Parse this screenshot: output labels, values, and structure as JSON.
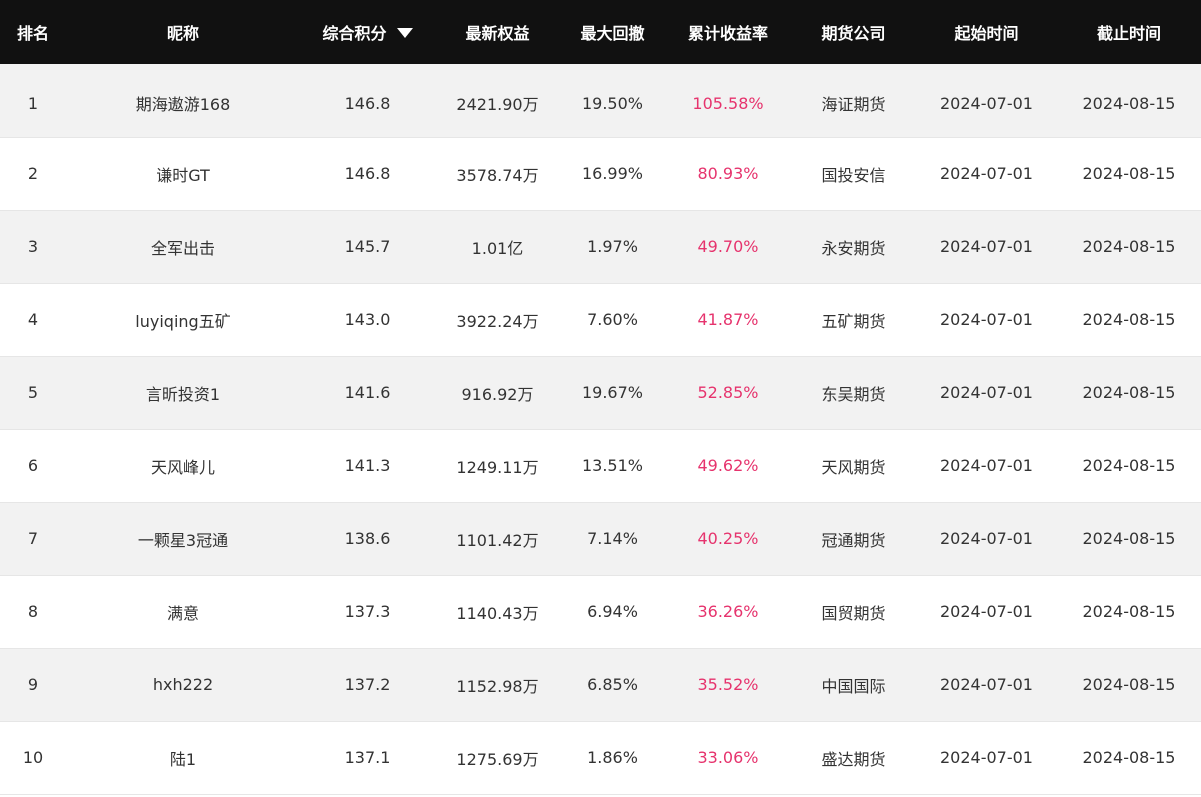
{
  "columns": {
    "rank": "排名",
    "nickname": "昵称",
    "score": "综合积分",
    "equity": "最新权益",
    "drawdown": "最大回撤",
    "return": "累计收益率",
    "company": "期货公司",
    "start": "起始时间",
    "end": "截止时间"
  },
  "sort": {
    "column": "score",
    "direction": "desc",
    "icon": "sort-down-triangle"
  },
  "colors": {
    "header_bg": "#111111",
    "return_color": "#e6336d",
    "stripe": "#f2f2f2"
  },
  "rows": [
    {
      "rank": "1",
      "nickname": "期海遨游168",
      "score": "146.8",
      "equity": "2421.90万",
      "drawdown": "19.50%",
      "return": "105.58%",
      "company": "海证期货",
      "start": "2024-07-01",
      "end": "2024-08-15"
    },
    {
      "rank": "2",
      "nickname": "谦时GT",
      "score": "146.8",
      "equity": "3578.74万",
      "drawdown": "16.99%",
      "return": "80.93%",
      "company": "国投安信",
      "start": "2024-07-01",
      "end": "2024-08-15"
    },
    {
      "rank": "3",
      "nickname": "全军出击",
      "score": "145.7",
      "equity": "1.01亿",
      "drawdown": "1.97%",
      "return": "49.70%",
      "company": "永安期货",
      "start": "2024-07-01",
      "end": "2024-08-15"
    },
    {
      "rank": "4",
      "nickname": "luyiqing五矿",
      "score": "143.0",
      "equity": "3922.24万",
      "drawdown": "7.60%",
      "return": "41.87%",
      "company": "五矿期货",
      "start": "2024-07-01",
      "end": "2024-08-15"
    },
    {
      "rank": "5",
      "nickname": "言昕投资1",
      "score": "141.6",
      "equity": "916.92万",
      "drawdown": "19.67%",
      "return": "52.85%",
      "company": "东吴期货",
      "start": "2024-07-01",
      "end": "2024-08-15"
    },
    {
      "rank": "6",
      "nickname": "天风峰儿",
      "score": "141.3",
      "equity": "1249.11万",
      "drawdown": "13.51%",
      "return": "49.62%",
      "company": "天风期货",
      "start": "2024-07-01",
      "end": "2024-08-15"
    },
    {
      "rank": "7",
      "nickname": "一颗星3冠通",
      "score": "138.6",
      "equity": "1101.42万",
      "drawdown": "7.14%",
      "return": "40.25%",
      "company": "冠通期货",
      "start": "2024-07-01",
      "end": "2024-08-15"
    },
    {
      "rank": "8",
      "nickname": "满意",
      "score": "137.3",
      "equity": "1140.43万",
      "drawdown": "6.94%",
      "return": "36.26%",
      "company": "国贸期货",
      "start": "2024-07-01",
      "end": "2024-08-15"
    },
    {
      "rank": "9",
      "nickname": "hxh222",
      "score": "137.2",
      "equity": "1152.98万",
      "drawdown": "6.85%",
      "return": "35.52%",
      "company": "中国国际",
      "start": "2024-07-01",
      "end": "2024-08-15"
    },
    {
      "rank": "10",
      "nickname": "陆1",
      "score": "137.1",
      "equity": "1275.69万",
      "drawdown": "1.86%",
      "return": "33.06%",
      "company": "盛达期货",
      "start": "2024-07-01",
      "end": "2024-08-15"
    }
  ]
}
